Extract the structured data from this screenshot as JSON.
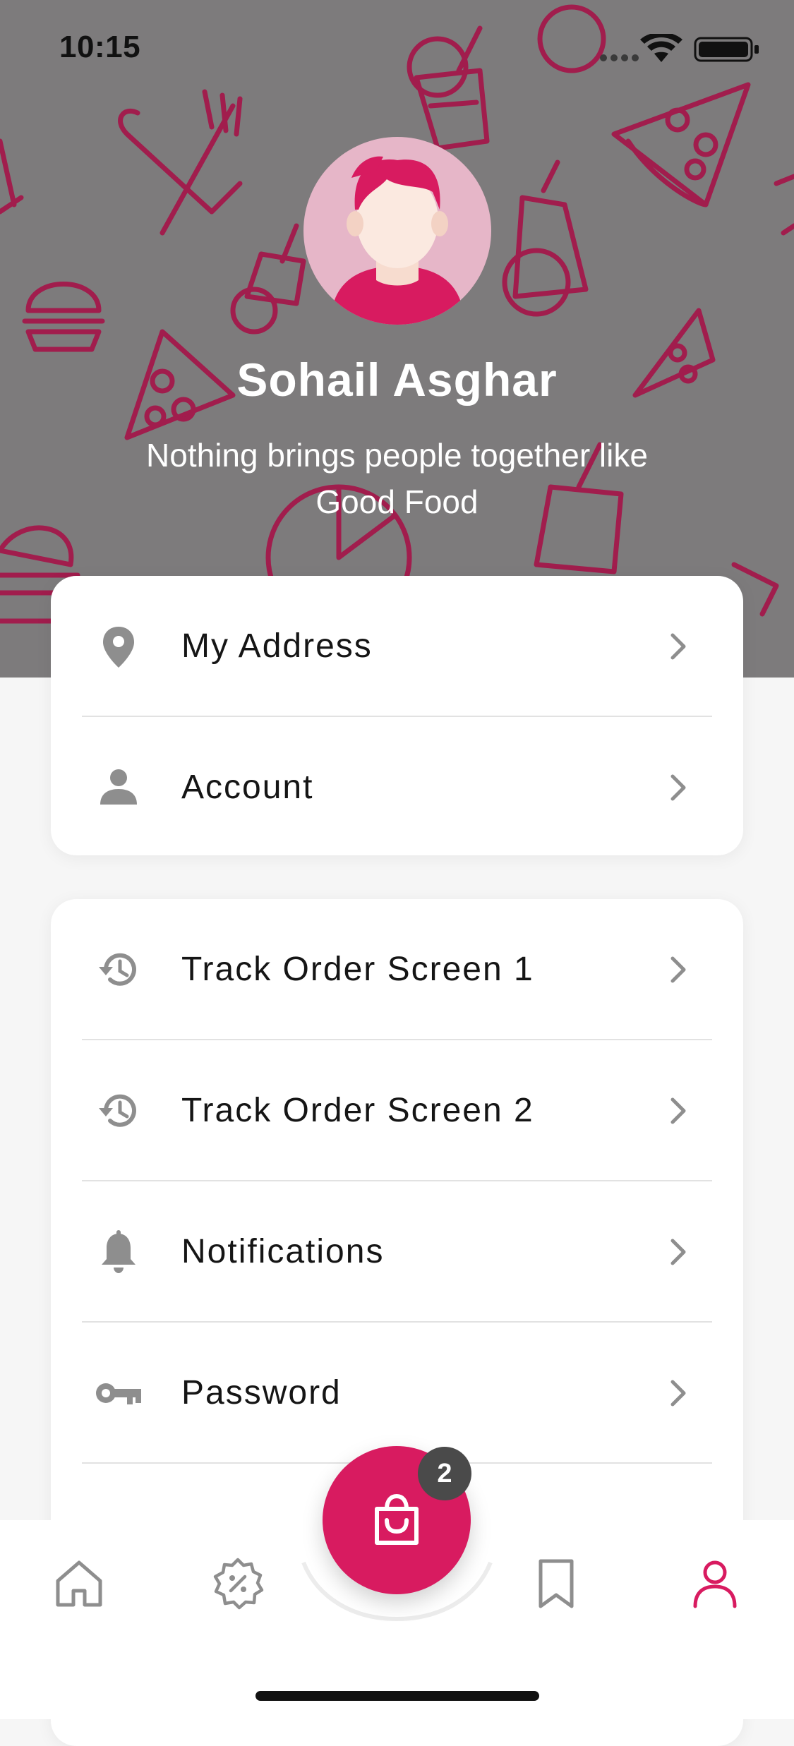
{
  "status_bar": {
    "time": "10:15",
    "icons": [
      "signal-icon",
      "wifi-icon",
      "battery-icon"
    ]
  },
  "profile": {
    "name": "Sohail Asghar",
    "tagline": "Nothing brings people together like Good Food",
    "avatar_icon": "user-avatar"
  },
  "menu_group_1": [
    {
      "label": "My Address",
      "icon": "location-pin-icon"
    },
    {
      "label": "Account",
      "icon": "person-icon"
    }
  ],
  "menu_group_2": [
    {
      "label": "Track Order Screen 1",
      "icon": "history-icon"
    },
    {
      "label": "Track Order Screen 2",
      "icon": "history-icon"
    },
    {
      "label": "Notifications",
      "icon": "bell-icon"
    },
    {
      "label": "Password",
      "icon": "key-icon"
    }
  ],
  "bottom_nav": {
    "items": [
      "home-icon",
      "discount-icon",
      "bookmark-icon",
      "profile-icon"
    ],
    "active": "profile-icon",
    "cart_icon": "shopping-bag-icon",
    "cart_badge": "2"
  },
  "colors": {
    "accent": "#d81b60",
    "header_overlay": "#7d7b7c",
    "icon_gray": "#8e8e8e",
    "badge": "#4a4a4a"
  }
}
